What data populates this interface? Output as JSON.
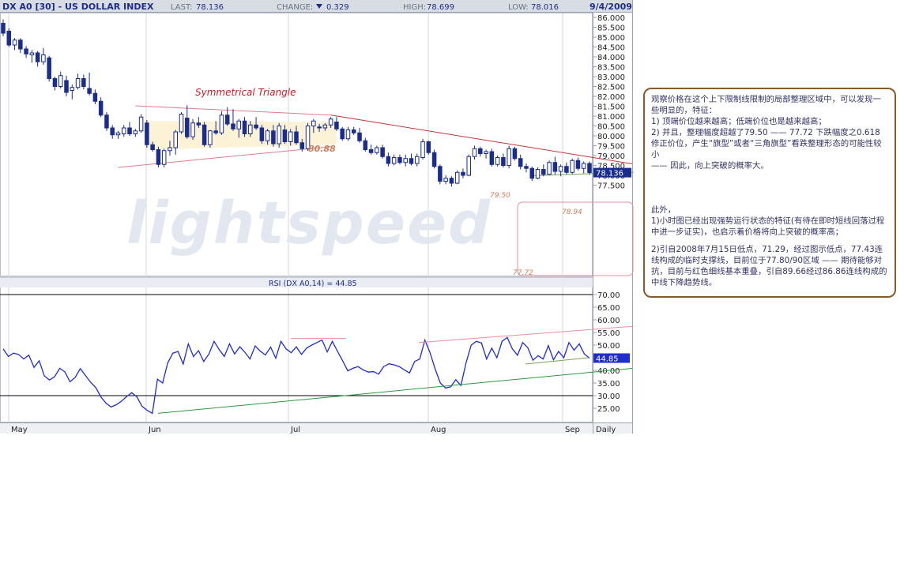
{
  "header": {
    "symbol": "DX A0 [30] - US DOLLAR INDEX",
    "last_label": "LAST:",
    "last_value": "78.136",
    "change_label": "CHANGE:",
    "change_value": "0.329",
    "high_label": "HIGH:",
    "high_value": "78.699",
    "low_label": "LOW:",
    "low_value": "78.016",
    "date": "9/4/2009"
  },
  "colors": {
    "candle_up": "#ffffff",
    "candle_down": "#1a2c8c",
    "candle_border": "#1a2c8c",
    "rsi_line": "#1f2cd0",
    "triangle_upper": "#e37b8c",
    "resistance": "#c8343c",
    "support_green": "#2e9a3e",
    "header_bg": "#d8dde4",
    "header_text": "#1f2d8a",
    "note_border": "#8B5A2B",
    "note_text": "#333366"
  },
  "annotations": {
    "pattern_title": "Symmetrical Triangle",
    "peak_8088": "80.88",
    "peak_7950": "79.50",
    "peak_7894": "78.94",
    "low_7772": "77.72",
    "low_7743": "77.43"
  },
  "price_axis": {
    "ticks": [
      "86.000",
      "85.500",
      "85.000",
      "84.500",
      "84.000",
      "83.500",
      "83.000",
      "82.500",
      "82.000",
      "81.500",
      "81.000",
      "80.500",
      "80.000",
      "79.500",
      "79.000",
      "78.500",
      "78.000",
      "77.500"
    ],
    "current_tag": "78.136"
  },
  "rsi": {
    "label": "RSI (DX A0,14) = 44.85",
    "ticks": [
      "70.00",
      "65.00",
      "60.00",
      "55.00",
      "50.00",
      "45.00",
      "40.00",
      "35.00",
      "30.00",
      "25.00"
    ],
    "current_tag": "44.85"
  },
  "time_axis": {
    "labels": [
      "May",
      "Jun",
      "Jul",
      "Aug",
      "Sep"
    ],
    "period": "Daily"
  },
  "chart_data": {
    "type": "candlestick",
    "title": "DX A0 [30] - US DOLLAR INDEX",
    "period": "Daily",
    "ylim": [
      77.3,
      86.1
    ],
    "candles": [
      {
        "o": 85.7,
        "h": 85.9,
        "l": 85.05,
        "c": 85.2
      },
      {
        "o": 85.3,
        "h": 85.45,
        "l": 84.5,
        "c": 84.6
      },
      {
        "o": 84.6,
        "h": 84.95,
        "l": 84.35,
        "c": 84.85
      },
      {
        "o": 84.85,
        "h": 84.95,
        "l": 84.2,
        "c": 84.4
      },
      {
        "o": 84.4,
        "h": 84.55,
        "l": 83.95,
        "c": 84.15
      },
      {
        "o": 84.1,
        "h": 84.35,
        "l": 83.7,
        "c": 84.2
      },
      {
        "o": 84.2,
        "h": 84.3,
        "l": 83.5,
        "c": 83.75
      },
      {
        "o": 83.75,
        "h": 84.45,
        "l": 83.6,
        "c": 84.1
      },
      {
        "o": 83.95,
        "h": 84.05,
        "l": 82.75,
        "c": 82.9
      },
      {
        "o": 82.9,
        "h": 83.0,
        "l": 82.3,
        "c": 82.5
      },
      {
        "o": 82.5,
        "h": 83.25,
        "l": 82.4,
        "c": 83.05
      },
      {
        "o": 82.8,
        "h": 83.05,
        "l": 82.0,
        "c": 82.2
      },
      {
        "o": 82.3,
        "h": 82.6,
        "l": 81.85,
        "c": 82.45
      },
      {
        "o": 82.45,
        "h": 83.15,
        "l": 82.35,
        "c": 82.9
      },
      {
        "o": 82.9,
        "h": 83.1,
        "l": 82.35,
        "c": 82.5
      },
      {
        "o": 82.4,
        "h": 83.2,
        "l": 82.05,
        "c": 82.15
      },
      {
        "o": 82.15,
        "h": 82.35,
        "l": 81.6,
        "c": 81.75
      },
      {
        "o": 81.75,
        "h": 81.95,
        "l": 80.95,
        "c": 81.05
      },
      {
        "o": 81.05,
        "h": 81.2,
        "l": 80.25,
        "c": 80.4
      },
      {
        "o": 80.4,
        "h": 80.55,
        "l": 79.85,
        "c": 80.05
      },
      {
        "o": 80.05,
        "h": 80.25,
        "l": 79.85,
        "c": 80.15
      },
      {
        "o": 80.1,
        "h": 80.55,
        "l": 79.95,
        "c": 80.4
      },
      {
        "o": 80.4,
        "h": 80.7,
        "l": 80.0,
        "c": 80.1
      },
      {
        "o": 80.1,
        "h": 80.35,
        "l": 79.95,
        "c": 80.25
      },
      {
        "o": 80.25,
        "h": 81.1,
        "l": 80.15,
        "c": 80.95
      },
      {
        "o": 80.65,
        "h": 80.8,
        "l": 79.4,
        "c": 79.55
      },
      {
        "o": 79.55,
        "h": 79.7,
        "l": 79.2,
        "c": 79.3
      },
      {
        "o": 79.3,
        "h": 79.45,
        "l": 78.4,
        "c": 78.55
      },
      {
        "o": 78.55,
        "h": 79.35,
        "l": 78.4,
        "c": 79.25
      },
      {
        "o": 79.25,
        "h": 79.75,
        "l": 79.0,
        "c": 79.4
      },
      {
        "o": 79.4,
        "h": 80.3,
        "l": 79.05,
        "c": 80.2
      },
      {
        "o": 80.2,
        "h": 81.2,
        "l": 80.1,
        "c": 81.1
      },
      {
        "o": 80.9,
        "h": 81.55,
        "l": 79.85,
        "c": 79.95
      },
      {
        "o": 79.95,
        "h": 80.85,
        "l": 79.8,
        "c": 80.65
      },
      {
        "o": 80.65,
        "h": 80.95,
        "l": 80.4,
        "c": 80.55
      },
      {
        "o": 80.55,
        "h": 80.7,
        "l": 79.45,
        "c": 79.55
      },
      {
        "o": 79.55,
        "h": 80.3,
        "l": 79.4,
        "c": 80.25
      },
      {
        "o": 80.25,
        "h": 80.75,
        "l": 80.05,
        "c": 80.15
      },
      {
        "o": 80.15,
        "h": 81.25,
        "l": 80.05,
        "c": 81.05
      },
      {
        "o": 81.05,
        "h": 81.45,
        "l": 80.5,
        "c": 80.6
      },
      {
        "o": 80.6,
        "h": 81.35,
        "l": 80.25,
        "c": 80.35
      },
      {
        "o": 80.35,
        "h": 80.85,
        "l": 79.9,
        "c": 80.75
      },
      {
        "o": 80.75,
        "h": 80.95,
        "l": 79.95,
        "c": 80.1
      },
      {
        "o": 80.1,
        "h": 80.75,
        "l": 79.95,
        "c": 80.55
      },
      {
        "o": 80.55,
        "h": 80.95,
        "l": 80.3,
        "c": 80.4
      },
      {
        "o": 80.4,
        "h": 80.55,
        "l": 79.6,
        "c": 79.75
      },
      {
        "o": 79.75,
        "h": 80.35,
        "l": 79.55,
        "c": 80.25
      },
      {
        "o": 80.25,
        "h": 80.55,
        "l": 79.45,
        "c": 79.6
      },
      {
        "o": 79.6,
        "h": 80.65,
        "l": 79.4,
        "c": 80.5
      },
      {
        "o": 80.3,
        "h": 80.55,
        "l": 79.6,
        "c": 79.7
      },
      {
        "o": 79.7,
        "h": 80.35,
        "l": 79.5,
        "c": 80.2
      },
      {
        "o": 80.2,
        "h": 80.5,
        "l": 79.55,
        "c": 79.65
      },
      {
        "o": 79.65,
        "h": 79.85,
        "l": 79.2,
        "c": 79.35
      },
      {
        "o": 79.35,
        "h": 80.65,
        "l": 79.25,
        "c": 80.5
      },
      {
        "o": 80.5,
        "h": 80.85,
        "l": 80.15,
        "c": 80.75
      },
      {
        "o": 80.45,
        "h": 80.6,
        "l": 80.2,
        "c": 80.4
      },
      {
        "o": 80.4,
        "h": 80.65,
        "l": 80.25,
        "c": 80.55
      },
      {
        "o": 80.55,
        "h": 80.95,
        "l": 80.4,
        "c": 80.85
      },
      {
        "o": 80.7,
        "h": 80.95,
        "l": 80.25,
        "c": 80.35
      },
      {
        "o": 80.35,
        "h": 80.45,
        "l": 79.75,
        "c": 79.85
      },
      {
        "o": 79.85,
        "h": 80.45,
        "l": 79.75,
        "c": 80.3
      },
      {
        "o": 80.3,
        "h": 80.45,
        "l": 80.05,
        "c": 80.15
      },
      {
        "o": 80.15,
        "h": 80.4,
        "l": 79.65,
        "c": 79.75
      },
      {
        "o": 79.75,
        "h": 79.9,
        "l": 79.2,
        "c": 79.3
      },
      {
        "o": 79.3,
        "h": 79.55,
        "l": 79.05,
        "c": 79.15
      },
      {
        "o": 79.15,
        "h": 79.5,
        "l": 79.05,
        "c": 79.4
      },
      {
        "o": 79.4,
        "h": 79.55,
        "l": 78.85,
        "c": 78.95
      },
      {
        "o": 78.95,
        "h": 79.15,
        "l": 78.45,
        "c": 78.6
      },
      {
        "o": 78.6,
        "h": 79.05,
        "l": 78.5,
        "c": 78.9
      },
      {
        "o": 78.9,
        "h": 79.05,
        "l": 78.55,
        "c": 78.65
      },
      {
        "o": 78.65,
        "h": 79.05,
        "l": 78.45,
        "c": 78.85
      },
      {
        "o": 78.85,
        "h": 79.1,
        "l": 78.5,
        "c": 78.6
      },
      {
        "o": 78.6,
        "h": 79.1,
        "l": 78.45,
        "c": 78.95
      },
      {
        "o": 78.9,
        "h": 79.85,
        "l": 78.8,
        "c": 79.7
      },
      {
        "o": 79.7,
        "h": 79.75,
        "l": 79.05,
        "c": 79.15
      },
      {
        "o": 79.15,
        "h": 79.3,
        "l": 78.35,
        "c": 78.45
      },
      {
        "o": 78.45,
        "h": 78.55,
        "l": 77.55,
        "c": 77.7
      },
      {
        "o": 77.7,
        "h": 78.0,
        "l": 77.55,
        "c": 77.85
      },
      {
        "o": 77.85,
        "h": 77.95,
        "l": 77.43,
        "c": 77.6
      },
      {
        "o": 77.6,
        "h": 78.25,
        "l": 77.55,
        "c": 78.15
      },
      {
        "o": 78.15,
        "h": 78.35,
        "l": 77.85,
        "c": 78.0
      },
      {
        "o": 78.0,
        "h": 79.05,
        "l": 77.95,
        "c": 78.95
      },
      {
        "o": 78.95,
        "h": 79.5,
        "l": 78.8,
        "c": 79.35
      },
      {
        "o": 79.35,
        "h": 79.45,
        "l": 78.95,
        "c": 79.1
      },
      {
        "o": 79.1,
        "h": 79.3,
        "l": 78.85,
        "c": 79.2
      },
      {
        "o": 79.2,
        "h": 79.35,
        "l": 78.45,
        "c": 78.55
      },
      {
        "o": 78.55,
        "h": 79.0,
        "l": 78.45,
        "c": 78.9
      },
      {
        "o": 78.9,
        "h": 79.1,
        "l": 78.4,
        "c": 78.5
      },
      {
        "o": 78.5,
        "h": 79.5,
        "l": 78.35,
        "c": 79.35
      },
      {
        "o": 79.35,
        "h": 79.45,
        "l": 78.75,
        "c": 78.85
      },
      {
        "o": 78.85,
        "h": 79.05,
        "l": 78.3,
        "c": 78.45
      },
      {
        "o": 78.45,
        "h": 78.6,
        "l": 78.15,
        "c": 78.35
      },
      {
        "o": 78.35,
        "h": 78.45,
        "l": 77.72,
        "c": 77.85
      },
      {
        "o": 77.85,
        "h": 78.4,
        "l": 77.8,
        "c": 78.3
      },
      {
        "o": 78.3,
        "h": 78.55,
        "l": 77.95,
        "c": 78.05
      },
      {
        "o": 78.05,
        "h": 78.75,
        "l": 78.0,
        "c": 78.65
      },
      {
        "o": 78.65,
        "h": 78.94,
        "l": 78.05,
        "c": 78.2
      },
      {
        "o": 78.2,
        "h": 78.55,
        "l": 77.95,
        "c": 78.45
      },
      {
        "o": 78.45,
        "h": 78.65,
        "l": 78.05,
        "c": 78.15
      },
      {
        "o": 78.15,
        "h": 78.85,
        "l": 78.05,
        "c": 78.75
      },
      {
        "o": 78.75,
        "h": 78.9,
        "l": 78.25,
        "c": 78.35
      },
      {
        "o": 78.35,
        "h": 78.7,
        "l": 78.1,
        "c": 78.6
      },
      {
        "o": 78.6,
        "h": 78.7,
        "l": 78.02,
        "c": 78.14
      }
    ],
    "rsi": {
      "name": "RSI (DX A0,14)",
      "current": 44.85,
      "ylim": [
        22,
        72
      ],
      "values": [
        48.5,
        45.5,
        46.8,
        46.3,
        44.5,
        46.0,
        41.2,
        43.8,
        37.8,
        36.2,
        37.5,
        40.8,
        39.4,
        35.5,
        37.2,
        40.7,
        38.0,
        35.3,
        33.2,
        29.5,
        27.0,
        25.5,
        26.4,
        27.8,
        29.6,
        31.2,
        29.5,
        25.8,
        24.2,
        23.0,
        36.5,
        35.0,
        43.0,
        46.8,
        47.5,
        42.5,
        50.5,
        45.5,
        47.8,
        43.5,
        46.5,
        51.5,
        48.2,
        45.5,
        50.5,
        46.5,
        49.3,
        47.2,
        44.5,
        49.7,
        47.6,
        46.1,
        49.2,
        44.8,
        51.5,
        48.5,
        47.0,
        49.3,
        46.3,
        48.8,
        50.0,
        51.0,
        52.0,
        47.3,
        51.5,
        47.5,
        43.8,
        39.8,
        40.8,
        41.5,
        40.2,
        39.3,
        39.5,
        38.5,
        41.5,
        42.6,
        42.2,
        41.5,
        40.2,
        39.0,
        43.5,
        44.5,
        52.0,
        47.0,
        40.5,
        35.0,
        33.0,
        33.5,
        36.3,
        34.0,
        43.0,
        50.0,
        51.5,
        50.8,
        44.5,
        48.8,
        45.0,
        51.5,
        53.0,
        48.5,
        46.0,
        51.0,
        49.0,
        44.0,
        45.8,
        44.5,
        49.8,
        44.2,
        47.5,
        45.0,
        51.0,
        48.0,
        50.5,
        46.5,
        44.85
      ]
    },
    "x_labels": [
      "May",
      "Jun",
      "Jul",
      "Aug",
      "Sep"
    ]
  },
  "note": {
    "para1": "观察价格在这个上下限制线限制的局部整理区域中，可以发现一些明显的，特征：\n1) 顶端价位越来越高；低端价位也是越来越高；\n2) 并且，整理幅度超越了79.50 —— 77.72 下跌幅度之0.618 修正价位，产生“旗型”或者“三角旗型”看跌整理形态的可能性较小\n—— 因此，向上突破的概率大。",
    "para2": "此外，\n1)小时图已经出现强势运行状态的特征(有待在即时短线回落过程中进一步证实)，也启示着价格将向上突破的概率高；",
    "para3": "2)引自2008年7月15日低点，71.29，经过图示低点，77.43连线构成的临时支撑线，目前位于77.80/90区域 —— 期待能够对抗，目前与红色细线基本重叠，引自89.66经过86.86连线构成的中线下降趋势线。"
  }
}
